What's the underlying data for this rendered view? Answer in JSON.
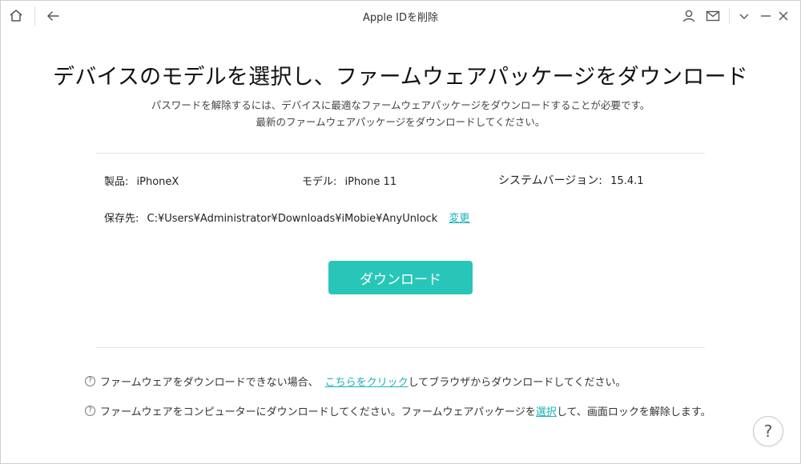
{
  "window": {
    "title": "Apple IDを削除"
  },
  "page": {
    "heading": "デバイスのモデルを選択し、ファームウェアパッケージをダウンロード",
    "subtitle_line1": "パスワードを解除するには、デバイスに最適なファームウェアパッケージをダウンロードすることが必要です。",
    "subtitle_line2": "最新のファームウェアパッケージをダウンロードしてください。"
  },
  "device": {
    "product_label": "製品:",
    "product_value": "iPhoneX",
    "model_label": "モデル:",
    "model_value": "iPhone 11",
    "system_label": "システムバージョン:",
    "system_value": "15.4.1",
    "save_label": "保存先:",
    "save_path": "C:¥Users¥Administrator¥Downloads¥iMobie¥AnyUnlock",
    "change_link": "変更"
  },
  "download_button": "ダウンロード",
  "notes": {
    "note1_prefix": "ファームウェアをダウンロードできない場合、",
    "note1_link": "こちらをクリック",
    "note1_suffix": "してブラウザからダウンロードしてください。",
    "note2_prefix": "ファームウェアをコンピューターにダウンロードしてください。ファームウェアパッケージを",
    "note2_link": "選択",
    "note2_suffix": "して、画面ロックを解除します。"
  },
  "help": "?",
  "colors": {
    "accent": "#27c6b8",
    "link": "#1ab0b8"
  }
}
